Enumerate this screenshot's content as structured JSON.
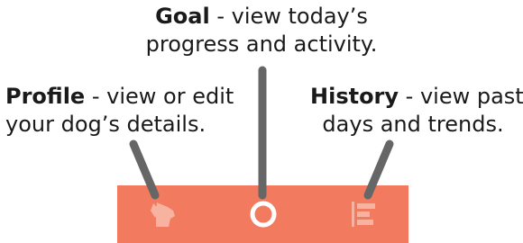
{
  "callouts": {
    "goal": {
      "term": "Goal",
      "rest_line1": " - view today’s",
      "line2": "progress and activity."
    },
    "profile": {
      "term": "Profile",
      "rest_line1": " - view or edit",
      "line2": "your dog’s details."
    },
    "history": {
      "term": "History",
      "rest_line1": " - view past",
      "line2": "days and trends."
    }
  },
  "tab_bar": {
    "tabs": [
      {
        "icon": "dog-head-icon",
        "state": "inactive"
      },
      {
        "icon": "goal-ring-icon",
        "state": "active"
      },
      {
        "icon": "history-bars-icon",
        "state": "inactive"
      }
    ]
  },
  "colors": {
    "tab_bar_bg": "#f27a5e",
    "icon_inactive": "#f7b3a0",
    "icon_active": "#ffffff",
    "pointer": "#666666",
    "text": "#1a1a1a"
  }
}
